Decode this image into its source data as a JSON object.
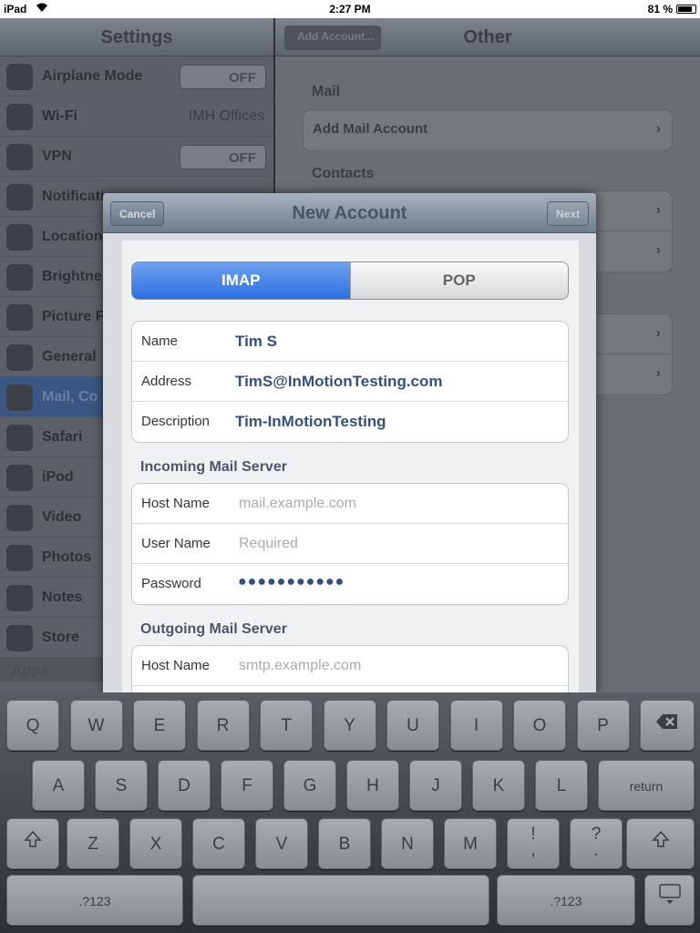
{
  "status": {
    "carrier": "iPad",
    "time": "2:27 PM",
    "battery": "81 %"
  },
  "settings": {
    "title": "Settings",
    "items": [
      {
        "label": "Airplane Mode",
        "icon": "airplane-icon",
        "toggle": "OFF"
      },
      {
        "label": "Wi-Fi",
        "icon": "wifi-icon",
        "value": "IMH Offices"
      },
      {
        "label": "VPN",
        "icon": "vpn-icon",
        "toggle": "OFF"
      },
      {
        "label": "Notificati",
        "icon": "notifications-icon"
      },
      {
        "label": "Location",
        "icon": "location-icon"
      },
      {
        "label": "Brightne",
        "icon": "brightness-icon"
      },
      {
        "label": "Picture F",
        "icon": "picture-frame-icon"
      },
      {
        "label": "General",
        "icon": "gear-icon"
      },
      {
        "label": "Mail, Co",
        "icon": "mail-icon"
      },
      {
        "label": "Safari",
        "icon": "safari-icon"
      },
      {
        "label": "iPod",
        "icon": "ipod-icon"
      },
      {
        "label": "Video",
        "icon": "video-icon"
      },
      {
        "label": "Photos",
        "icon": "photos-icon"
      },
      {
        "label": "Notes",
        "icon": "notes-icon"
      },
      {
        "label": "Store",
        "icon": "store-icon"
      }
    ],
    "apps_header": "Apps"
  },
  "detail": {
    "back_label": "Add Account...",
    "title": "Other",
    "mail_header": "Mail",
    "add_mail_account": "Add Mail Account",
    "contacts_header": "Contacts"
  },
  "modal": {
    "title": "New Account",
    "cancel": "Cancel",
    "next": "Next",
    "segments": {
      "imap": "IMAP",
      "pop": "POP"
    },
    "name_label": "Name",
    "name_value": "Tim S",
    "address_label": "Address",
    "address_value": "TimS@InMotionTesting.com",
    "description_label": "Description",
    "description_value": "Tim-InMotionTesting",
    "incoming_header": "Incoming Mail Server",
    "incoming": {
      "host_label": "Host Name",
      "host_placeholder": "mail.example.com",
      "user_label": "User Name",
      "user_placeholder": "Required",
      "password_label": "Password",
      "password_value": "●●●●●●●●●●●"
    },
    "outgoing_header": "Outgoing Mail Server",
    "outgoing": {
      "host_label": "Host Name",
      "host_placeholder": "smtp.example.com"
    }
  },
  "keyboard": {
    "row1": [
      "Q",
      "W",
      "E",
      "R",
      "T",
      "Y",
      "U",
      "I",
      "O",
      "P"
    ],
    "row2": [
      "A",
      "S",
      "D",
      "F",
      "G",
      "H",
      "J",
      "K",
      "L"
    ],
    "row3": [
      "Z",
      "X",
      "C",
      "V",
      "B",
      "N",
      "M",
      "!\n,",
      "?\n."
    ],
    "return": "return",
    "numbers": ".?123",
    "delete_icon": "backspace-icon",
    "shift_icon": "shift-icon",
    "hide_icon": "keyboard-hide-icon"
  }
}
